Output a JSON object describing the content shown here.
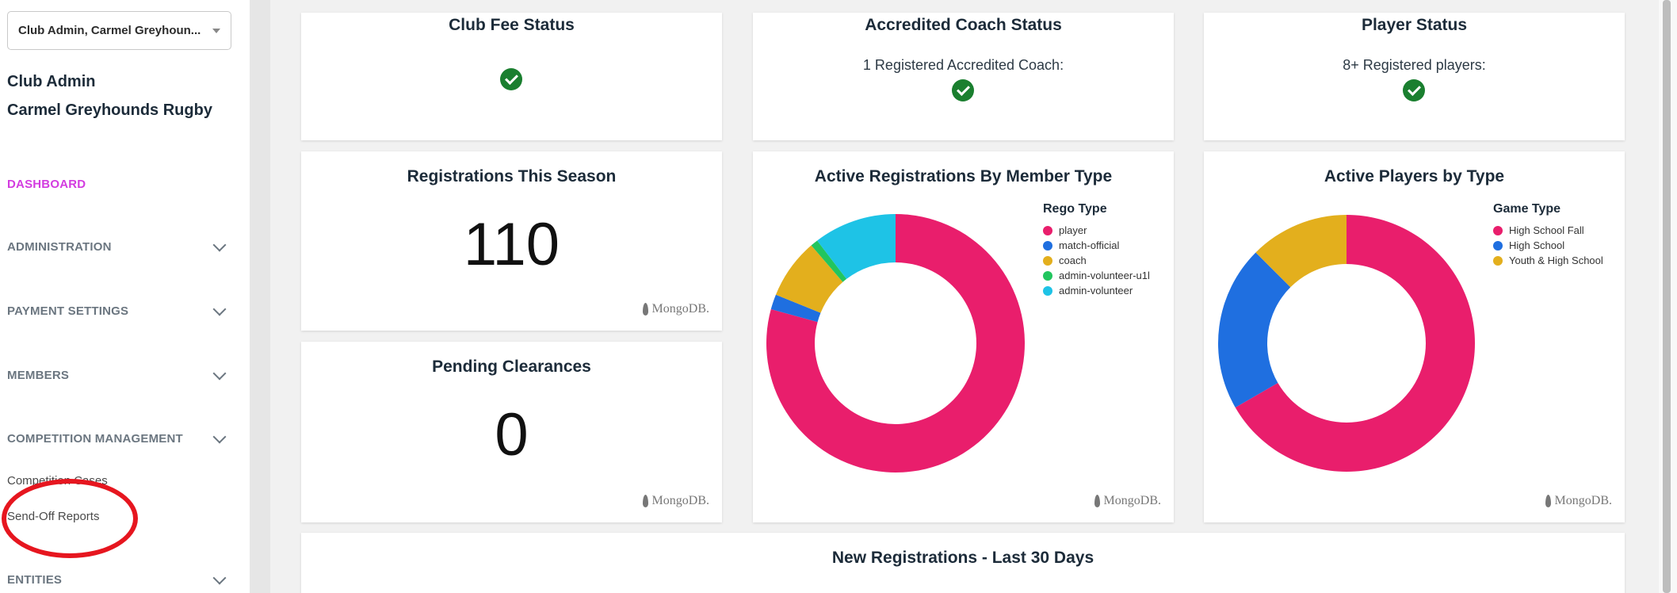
{
  "sidebar": {
    "role_select": "Club Admin, Carmel Greyhoun...",
    "user_role": "Club Admin",
    "user_club": "Carmel Greyhounds Rugby",
    "nav": {
      "dashboard": "DASHBOARD",
      "administration": "ADMINISTRATION",
      "payment_settings": "PAYMENT SETTINGS",
      "members": "MEMBERS",
      "competition_management": "COMPETITION MANAGEMENT",
      "competition_cases": "Competition Cases",
      "send_off_reports": "Send-Off Reports",
      "entities": "ENTITIES"
    }
  },
  "cards": {
    "club_fee": {
      "title": "Club Fee Status"
    },
    "coach": {
      "title": "Accredited Coach Status",
      "subtext": "1 Registered Accredited Coach:"
    },
    "player_status": {
      "title": "Player Status",
      "subtext": "8+ Registered players:"
    },
    "registrations": {
      "title": "Registrations This Season",
      "value": "110",
      "watermark": "MongoDB."
    },
    "pending": {
      "title": "Pending Clearances",
      "value": "0",
      "watermark": "MongoDB."
    },
    "new_regs": {
      "title": "New Registrations - Last 30 Days"
    }
  },
  "chart_data": [
    {
      "type": "pie",
      "title": "Active Registrations By Member Type",
      "legend_title": "Rego Type",
      "legend_position": "top-right",
      "watermark": "MongoDB.",
      "slices": [
        {
          "label": "player",
          "value": 84,
          "color": "#e91e6c"
        },
        {
          "label": "match-official",
          "value": 2,
          "color": "#1f6fe0"
        },
        {
          "label": "coach",
          "value": 8,
          "color": "#e3af1d"
        },
        {
          "label": "admin-volunteer-u1l",
          "value": 1,
          "color": "#22c55e"
        },
        {
          "label": "admin-volunteer",
          "value": 11,
          "color": "#1ec3e6"
        }
      ]
    },
    {
      "type": "pie",
      "title": "Active Players by Type",
      "legend_title": "Game Type",
      "legend_position": "top-right",
      "watermark": "MongoDB.",
      "slices": [
        {
          "label": "High School Fall",
          "value": 64,
          "color": "#e91e6c"
        },
        {
          "label": "High School",
          "value": 20,
          "color": "#1f6fe0"
        },
        {
          "label": "Youth & High School",
          "value": 12,
          "color": "#e3af1d"
        }
      ]
    }
  ]
}
